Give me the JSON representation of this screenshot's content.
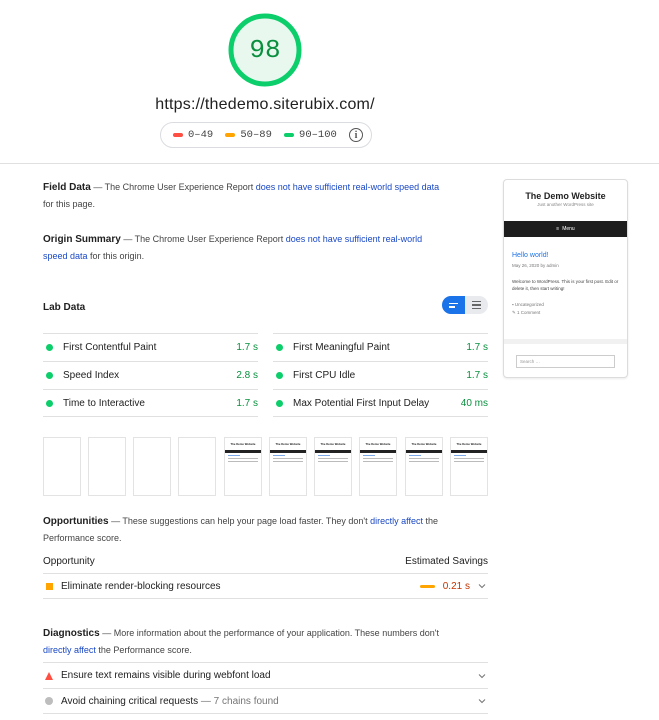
{
  "score": {
    "value": "98",
    "color": "#0cce6b"
  },
  "url": "https://thedemo.siterubix.com/",
  "legend": [
    {
      "label": "0–49",
      "color": "#ff4e42"
    },
    {
      "label": "50–89",
      "color": "#ffa400"
    },
    {
      "label": "90–100",
      "color": "#0cce6b"
    }
  ],
  "field_data": {
    "title": "Field Data",
    "pre": "— The Chrome User Experience Report ",
    "link": "does not have sufficient real-world speed data",
    "post": " for this page."
  },
  "origin_summary": {
    "title": "Origin Summary",
    "pre": "— The Chrome User Experience Report ",
    "link": "does not have sufficient real-world speed data",
    "post": " for this origin."
  },
  "lab_data": {
    "title": "Lab Data",
    "metrics": [
      {
        "name": "First Contentful Paint",
        "value": "1.7 s"
      },
      {
        "name": "First Meaningful Paint",
        "value": "1.7 s"
      },
      {
        "name": "Speed Index",
        "value": "2.8 s"
      },
      {
        "name": "First CPU Idle",
        "value": "1.7 s"
      },
      {
        "name": "Time to Interactive",
        "value": "1.7 s"
      },
      {
        "name": "Max Potential First Input Delay",
        "value": "40 ms"
      }
    ]
  },
  "thumb": {
    "site": "The Demo Website",
    "menu": "Menu",
    "tagline": "Just another WordPress site"
  },
  "opportunities": {
    "title": "Opportunities",
    "pre": "— These suggestions can help your page load faster. They don't ",
    "link": "directly affect",
    "post": " the Performance score.",
    "col_left": "Opportunity",
    "col_right": "Estimated Savings",
    "items": [
      {
        "name": "Eliminate render-blocking resources",
        "savings": "0.21 s"
      }
    ]
  },
  "diagnostics": {
    "title": "Diagnostics",
    "pre": "— More information about the performance of your application. These numbers don't ",
    "link": "directly affect",
    "post": " the Performance score.",
    "items": [
      {
        "name": "Ensure text remains visible during webfont load",
        "detail": ""
      },
      {
        "name": "Avoid chaining critical requests",
        "detail": "— 7 chains found"
      }
    ]
  },
  "preview": {
    "site_title": "The Demo Website",
    "tagline": "Just another WordPress site",
    "menu": "Menu",
    "post_title": "Hello world!",
    "post_date": "May 26, 2020 by admin",
    "post_body": "Welcome to WordPress. This is your first post. Edit or delete it, then start writing!",
    "category": "Uncategorized",
    "comments": "1 Comment",
    "search_placeholder": "Search …"
  }
}
